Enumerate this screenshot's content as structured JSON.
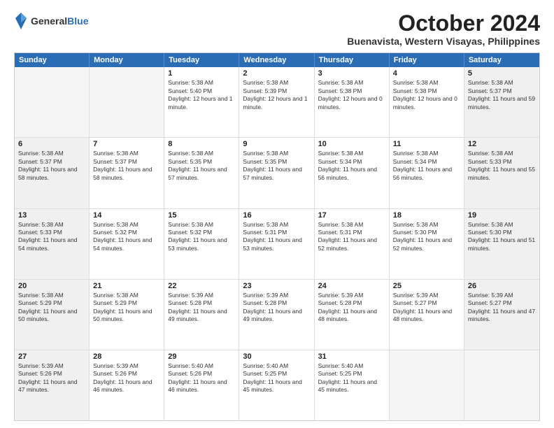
{
  "header": {
    "logo_line1": "General",
    "logo_line2": "Blue",
    "title": "October 2024",
    "subtitle": "Buenavista, Western Visayas, Philippines"
  },
  "weekdays": [
    "Sunday",
    "Monday",
    "Tuesday",
    "Wednesday",
    "Thursday",
    "Friday",
    "Saturday"
  ],
  "rows": [
    [
      {
        "day": "",
        "text": "",
        "empty": true
      },
      {
        "day": "",
        "text": "",
        "empty": true
      },
      {
        "day": "1",
        "text": "Sunrise: 5:38 AM\nSunset: 5:40 PM\nDaylight: 12 hours and 1 minute."
      },
      {
        "day": "2",
        "text": "Sunrise: 5:38 AM\nSunset: 5:39 PM\nDaylight: 12 hours and 1 minute."
      },
      {
        "day": "3",
        "text": "Sunrise: 5:38 AM\nSunset: 5:38 PM\nDaylight: 12 hours and 0 minutes."
      },
      {
        "day": "4",
        "text": "Sunrise: 5:38 AM\nSunset: 5:38 PM\nDaylight: 12 hours and 0 minutes."
      },
      {
        "day": "5",
        "text": "Sunrise: 5:38 AM\nSunset: 5:37 PM\nDaylight: 11 hours and 59 minutes."
      }
    ],
    [
      {
        "day": "6",
        "text": "Sunrise: 5:38 AM\nSunset: 5:37 PM\nDaylight: 11 hours and 58 minutes."
      },
      {
        "day": "7",
        "text": "Sunrise: 5:38 AM\nSunset: 5:37 PM\nDaylight: 11 hours and 58 minutes."
      },
      {
        "day": "8",
        "text": "Sunrise: 5:38 AM\nSunset: 5:35 PM\nDaylight: 11 hours and 57 minutes."
      },
      {
        "day": "9",
        "text": "Sunrise: 5:38 AM\nSunset: 5:35 PM\nDaylight: 11 hours and 57 minutes."
      },
      {
        "day": "10",
        "text": "Sunrise: 5:38 AM\nSunset: 5:34 PM\nDaylight: 11 hours and 56 minutes."
      },
      {
        "day": "11",
        "text": "Sunrise: 5:38 AM\nSunset: 5:34 PM\nDaylight: 11 hours and 56 minutes."
      },
      {
        "day": "12",
        "text": "Sunrise: 5:38 AM\nSunset: 5:33 PM\nDaylight: 11 hours and 55 minutes."
      }
    ],
    [
      {
        "day": "13",
        "text": "Sunrise: 5:38 AM\nSunset: 5:33 PM\nDaylight: 11 hours and 54 minutes."
      },
      {
        "day": "14",
        "text": "Sunrise: 5:38 AM\nSunset: 5:32 PM\nDaylight: 11 hours and 54 minutes."
      },
      {
        "day": "15",
        "text": "Sunrise: 5:38 AM\nSunset: 5:32 PM\nDaylight: 11 hours and 53 minutes."
      },
      {
        "day": "16",
        "text": "Sunrise: 5:38 AM\nSunset: 5:31 PM\nDaylight: 11 hours and 53 minutes."
      },
      {
        "day": "17",
        "text": "Sunrise: 5:38 AM\nSunset: 5:31 PM\nDaylight: 11 hours and 52 minutes."
      },
      {
        "day": "18",
        "text": "Sunrise: 5:38 AM\nSunset: 5:30 PM\nDaylight: 11 hours and 52 minutes."
      },
      {
        "day": "19",
        "text": "Sunrise: 5:38 AM\nSunset: 5:30 PM\nDaylight: 11 hours and 51 minutes."
      }
    ],
    [
      {
        "day": "20",
        "text": "Sunrise: 5:38 AM\nSunset: 5:29 PM\nDaylight: 11 hours and 50 minutes."
      },
      {
        "day": "21",
        "text": "Sunrise: 5:38 AM\nSunset: 5:29 PM\nDaylight: 11 hours and 50 minutes."
      },
      {
        "day": "22",
        "text": "Sunrise: 5:39 AM\nSunset: 5:28 PM\nDaylight: 11 hours and 49 minutes."
      },
      {
        "day": "23",
        "text": "Sunrise: 5:39 AM\nSunset: 5:28 PM\nDaylight: 11 hours and 49 minutes."
      },
      {
        "day": "24",
        "text": "Sunrise: 5:39 AM\nSunset: 5:28 PM\nDaylight: 11 hours and 48 minutes."
      },
      {
        "day": "25",
        "text": "Sunrise: 5:39 AM\nSunset: 5:27 PM\nDaylight: 11 hours and 48 minutes."
      },
      {
        "day": "26",
        "text": "Sunrise: 5:39 AM\nSunset: 5:27 PM\nDaylight: 11 hours and 47 minutes."
      }
    ],
    [
      {
        "day": "27",
        "text": "Sunrise: 5:39 AM\nSunset: 5:26 PM\nDaylight: 11 hours and 47 minutes."
      },
      {
        "day": "28",
        "text": "Sunrise: 5:39 AM\nSunset: 5:26 PM\nDaylight: 11 hours and 46 minutes."
      },
      {
        "day": "29",
        "text": "Sunrise: 5:40 AM\nSunset: 5:26 PM\nDaylight: 11 hours and 46 minutes."
      },
      {
        "day": "30",
        "text": "Sunrise: 5:40 AM\nSunset: 5:25 PM\nDaylight: 11 hours and 45 minutes."
      },
      {
        "day": "31",
        "text": "Sunrise: 5:40 AM\nSunset: 5:25 PM\nDaylight: 11 hours and 45 minutes."
      },
      {
        "day": "",
        "text": "",
        "empty": true
      },
      {
        "day": "",
        "text": "",
        "empty": true
      }
    ]
  ]
}
